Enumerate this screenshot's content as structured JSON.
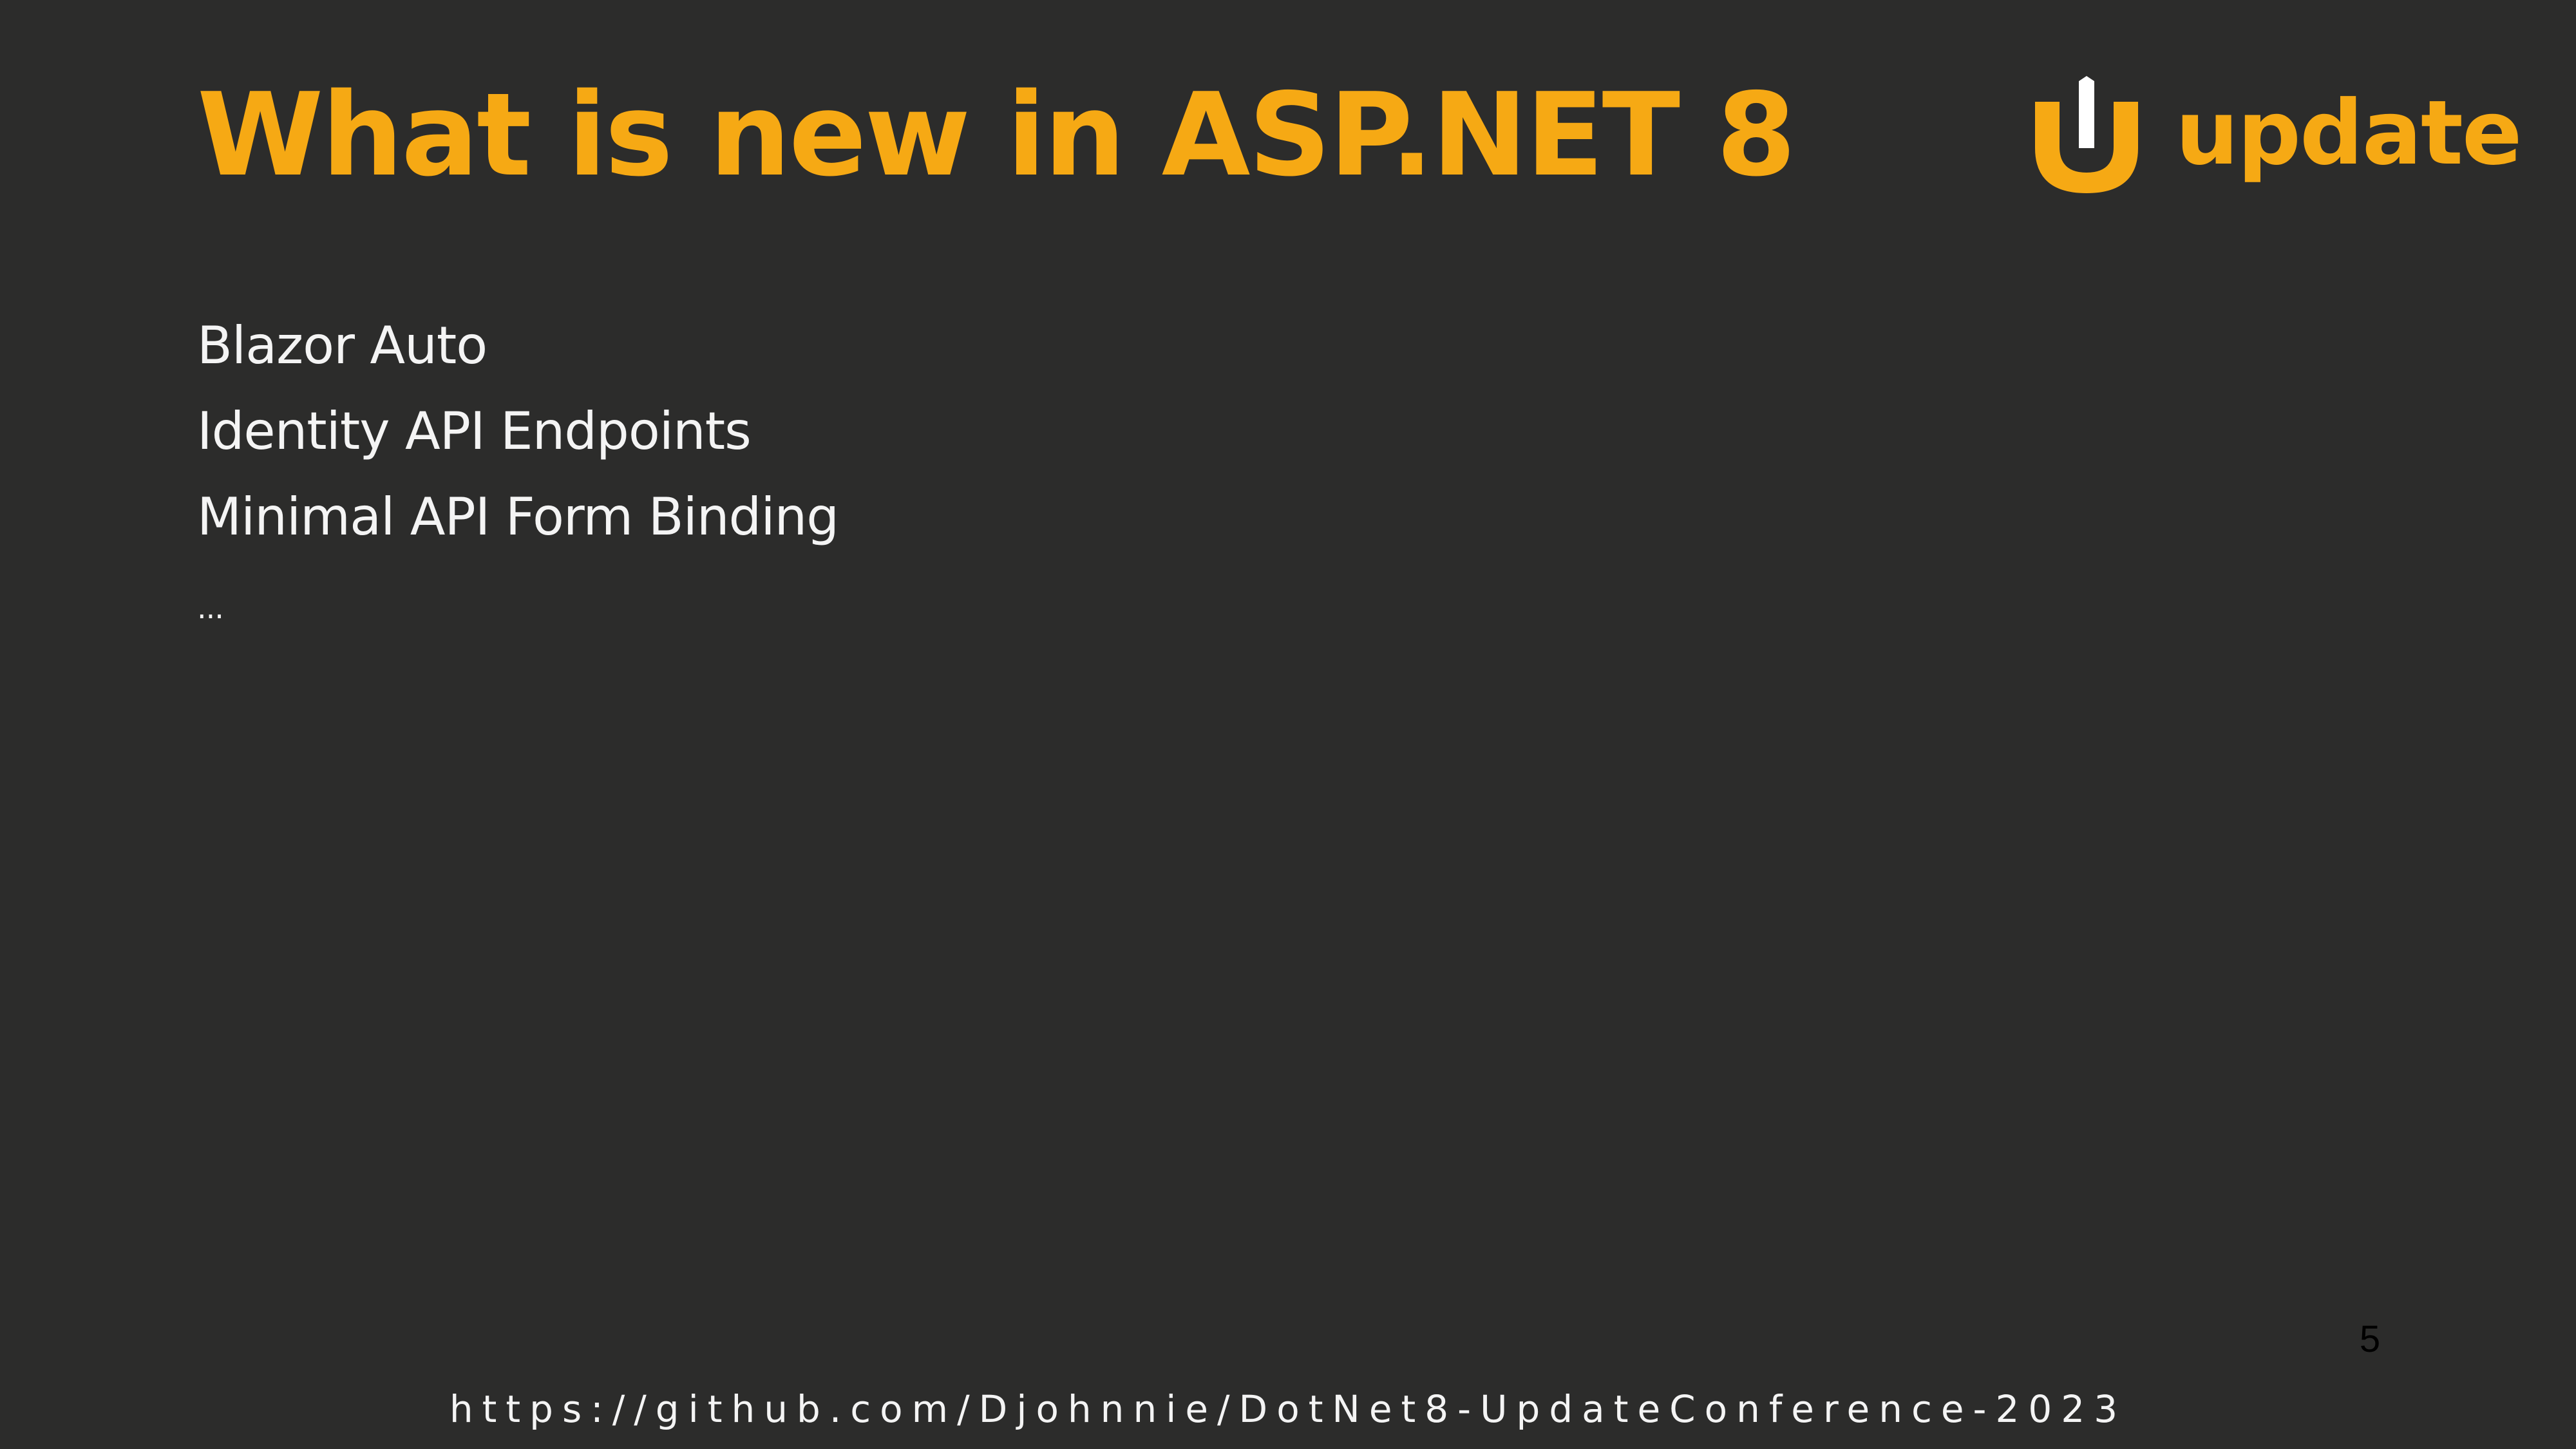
{
  "slide": {
    "title": "What is new in ASP.NET 8",
    "logo_text": "update",
    "bullets": [
      "Blazor Auto",
      "Identity API Endpoints",
      "Minimal API Form Binding",
      "..."
    ],
    "page_number": "5",
    "footer_url": "https://github.com/Djohnnie/DotNet8-UpdateConference-2023"
  },
  "colors": {
    "background": "#2c2c2b",
    "accent": "#f6a914",
    "text": "#f4f4f4",
    "logo_mark_inner": "#ffffff"
  },
  "icons": {
    "logo": "update-conference-logo-icon"
  }
}
